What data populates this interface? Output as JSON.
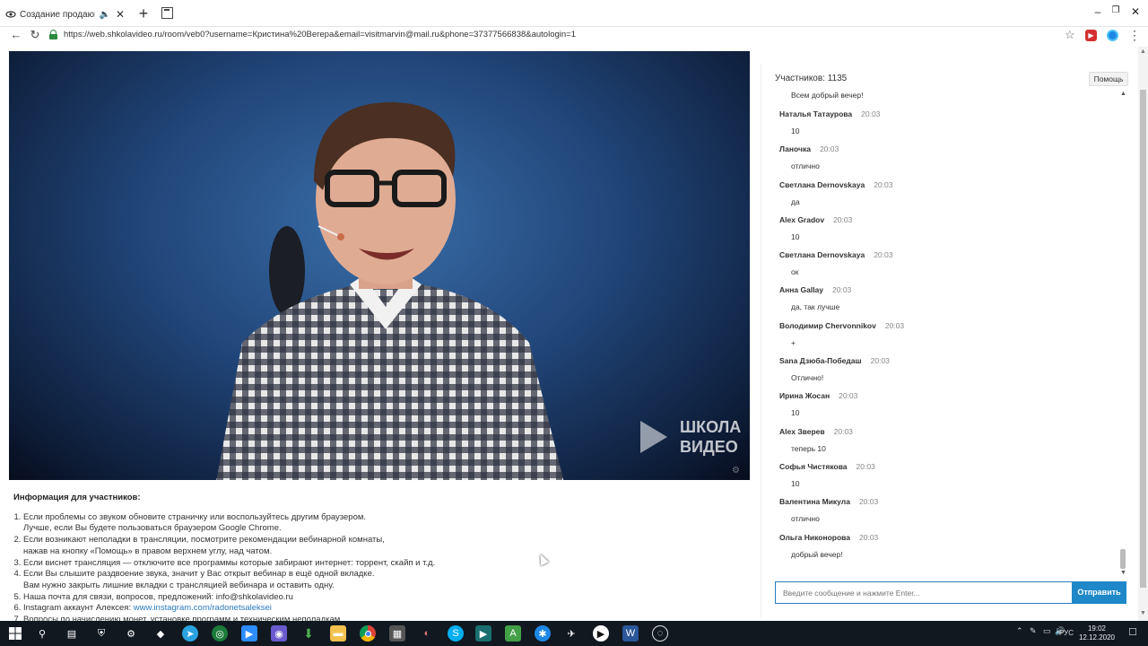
{
  "browser": {
    "tab_title": "Создание продающих в",
    "url": "https://web.shkolavideo.ru/room/veb0?username=Кристина%20Вегера&email=visitmarvin@mail.ru&phone=37377566838&autologin=1"
  },
  "video": {
    "logo_line1": "ШКОЛА",
    "logo_line2": "ВИДЕО"
  },
  "info": {
    "heading": "Информация для участников:",
    "items": [
      {
        "line1": "Если проблемы со звуком обновите страничку или воспользуйтесь другим браузером.",
        "line2": "Лучше, если Вы будете пользоваться браузером Google Chrome."
      },
      {
        "line1": "Если возникают неполадки в трансляции, посмотрите рекомендации вебинарной комнаты,",
        "line2": "нажав на кнопку «Помощь» в правом верхнем углу, над чатом."
      },
      {
        "line1": "Если виснет трансляция — отключите все программы которые забирают интернет: торрент, скайп и т.д.",
        "line2": ""
      },
      {
        "line1": "Если Вы слышите раздвоение звука, значит у Вас открыт вебинар в ещё одной вкладке.",
        "line2": "Вам нужно закрыть лишние вкладки с трансляцией вебинара и оставить одну."
      },
      {
        "line1": "Наша почта для связи, вопросов, предложений: info@shkolavideo.ru",
        "line2": ""
      }
    ],
    "instagram_prefix": "Instagram аккаунт Алексея: ",
    "instagram_link": "www.instagram.com/radonetsaleksei",
    "last_item": "Вопросы по начислению монет, установке программ и техническим неполадкам"
  },
  "chat": {
    "participants": "Участников: 1135",
    "help_label": "Помощь",
    "first_message": "Всем добрый вечер!",
    "messages": [
      {
        "author": "Наталья Татаурова",
        "time": "20:03",
        "text": "10"
      },
      {
        "author": "Ланочка",
        "time": "20:03",
        "text": "отлично"
      },
      {
        "author": "Светлана Dernovskaya",
        "time": "20:03",
        "text": "да"
      },
      {
        "author": "Alex Gradov",
        "time": "20:03",
        "text": "10"
      },
      {
        "author": "Светлана Dernovskaya",
        "time": "20:03",
        "text": "ок"
      },
      {
        "author": "Анна Gallay",
        "time": "20:03",
        "text": "да, так лучше"
      },
      {
        "author": "Володимир Chervonnikov",
        "time": "20:03",
        "text": "+"
      },
      {
        "author": "Sana Дзюба-Победаш",
        "time": "20:03",
        "text": "Отлично!"
      },
      {
        "author": "Ирина Жосан",
        "time": "20:03",
        "text": "10"
      },
      {
        "author": "Alex Зверев",
        "time": "20:03",
        "text": "теперь 10"
      },
      {
        "author": "Софья Чистякова",
        "time": "20:03",
        "text": "10"
      },
      {
        "author": "Валентина Микула",
        "time": "20:03",
        "text": "отлично"
      },
      {
        "author": "Ольга Никонорова",
        "time": "20:03",
        "text": "добрый вечер!"
      }
    ],
    "input_placeholder": "Введите сообщение и нажмите Enter...",
    "send_label": "Отправить"
  },
  "taskbar": {
    "lang": "РУС",
    "time": "19:02",
    "date": "12.12.2020"
  }
}
